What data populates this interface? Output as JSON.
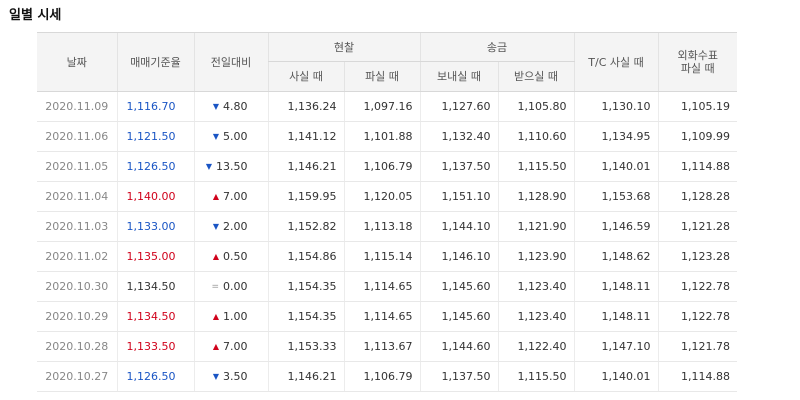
{
  "section_title": "일별 시세",
  "headers": {
    "date": "날짜",
    "base_rate": "매매기준율",
    "change": "전일대비",
    "cash": "현찰",
    "transfer": "송금",
    "tc_buy": "T/C 사실 때",
    "foreign_check_line1": "외화수표",
    "foreign_check_line2": "파실 때",
    "cash_buy": "사실 때",
    "cash_sell": "파실 때",
    "transfer_send": "보내실 때",
    "transfer_receive": "받으실 때"
  },
  "colors": {
    "up": "#d0021b",
    "down": "#1a55c4",
    "flat": "#333333"
  },
  "icons": {
    "up": "▲",
    "down": "▼",
    "flat": "="
  },
  "rows": [
    {
      "date": "2020.11.09",
      "base": "1,116.70",
      "dir": "down",
      "change": "4.80",
      "cash_buy": "1,136.24",
      "cash_sell": "1,097.16",
      "send": "1,127.60",
      "receive": "1,105.80",
      "tc": "1,130.10",
      "check": "1,105.19"
    },
    {
      "date": "2020.11.06",
      "base": "1,121.50",
      "dir": "down",
      "change": "5.00",
      "cash_buy": "1,141.12",
      "cash_sell": "1,101.88",
      "send": "1,132.40",
      "receive": "1,110.60",
      "tc": "1,134.95",
      "check": "1,109.99"
    },
    {
      "date": "2020.11.05",
      "base": "1,126.50",
      "dir": "down",
      "change": "13.50",
      "cash_buy": "1,146.21",
      "cash_sell": "1,106.79",
      "send": "1,137.50",
      "receive": "1,115.50",
      "tc": "1,140.01",
      "check": "1,114.88"
    },
    {
      "date": "2020.11.04",
      "base": "1,140.00",
      "dir": "up",
      "change": "7.00",
      "cash_buy": "1,159.95",
      "cash_sell": "1,120.05",
      "send": "1,151.10",
      "receive": "1,128.90",
      "tc": "1,153.68",
      "check": "1,128.28"
    },
    {
      "date": "2020.11.03",
      "base": "1,133.00",
      "dir": "down",
      "change": "2.00",
      "cash_buy": "1,152.82",
      "cash_sell": "1,113.18",
      "send": "1,144.10",
      "receive": "1,121.90",
      "tc": "1,146.59",
      "check": "1,121.28"
    },
    {
      "date": "2020.11.02",
      "base": "1,135.00",
      "dir": "up",
      "change": "0.50",
      "cash_buy": "1,154.86",
      "cash_sell": "1,115.14",
      "send": "1,146.10",
      "receive": "1,123.90",
      "tc": "1,148.62",
      "check": "1,123.28"
    },
    {
      "date": "2020.10.30",
      "base": "1,134.50",
      "dir": "flat",
      "change": "0.00",
      "cash_buy": "1,154.35",
      "cash_sell": "1,114.65",
      "send": "1,145.60",
      "receive": "1,123.40",
      "tc": "1,148.11",
      "check": "1,122.78"
    },
    {
      "date": "2020.10.29",
      "base": "1,134.50",
      "dir": "up",
      "change": "1.00",
      "cash_buy": "1,154.35",
      "cash_sell": "1,114.65",
      "send": "1,145.60",
      "receive": "1,123.40",
      "tc": "1,148.11",
      "check": "1,122.78"
    },
    {
      "date": "2020.10.28",
      "base": "1,133.50",
      "dir": "up",
      "change": "7.00",
      "cash_buy": "1,153.33",
      "cash_sell": "1,113.67",
      "send": "1,144.60",
      "receive": "1,122.40",
      "tc": "1,147.10",
      "check": "1,121.78"
    },
    {
      "date": "2020.10.27",
      "base": "1,126.50",
      "dir": "down",
      "change": "3.50",
      "cash_buy": "1,146.21",
      "cash_sell": "1,106.79",
      "send": "1,137.50",
      "receive": "1,115.50",
      "tc": "1,140.01",
      "check": "1,114.88"
    }
  ]
}
